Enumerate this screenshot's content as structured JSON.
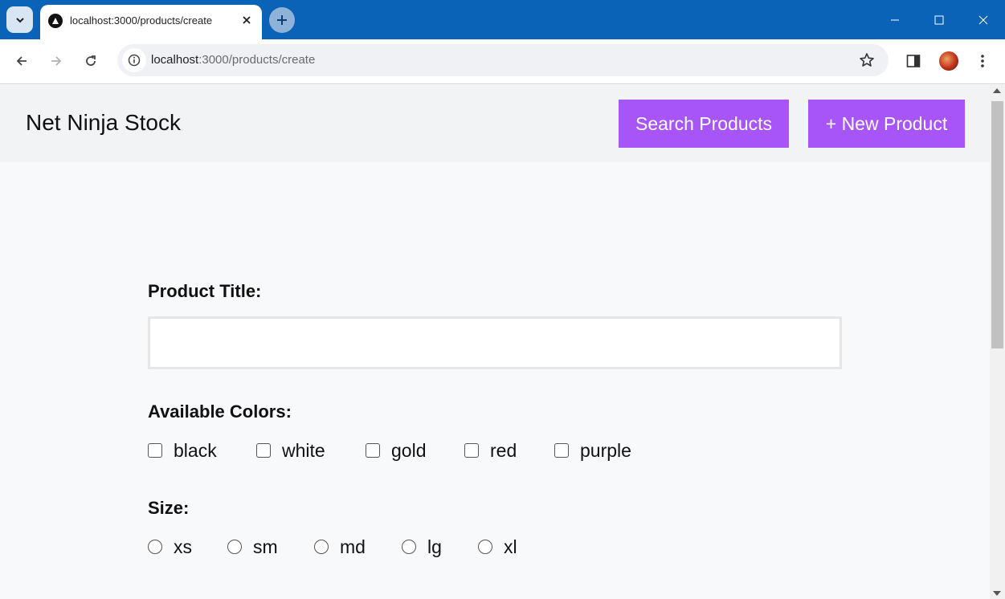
{
  "browser": {
    "tab_title": "localhost:3000/products/create",
    "url_host": "localhost",
    "url_path": ":3000/products/create"
  },
  "navbar": {
    "brand": "Net Ninja Stock",
    "search_button": "Search Products",
    "new_button": "+ New Product"
  },
  "form": {
    "title_label": "Product Title:",
    "title_value": "",
    "colors_label": "Available Colors:",
    "colors": [
      "black",
      "white",
      "gold",
      "red",
      "purple"
    ],
    "size_label": "Size:",
    "sizes": [
      "xs",
      "sm",
      "md",
      "lg",
      "xl"
    ]
  },
  "colors": {
    "accent": "#a855f7",
    "titlebar": "#0a63b6"
  }
}
